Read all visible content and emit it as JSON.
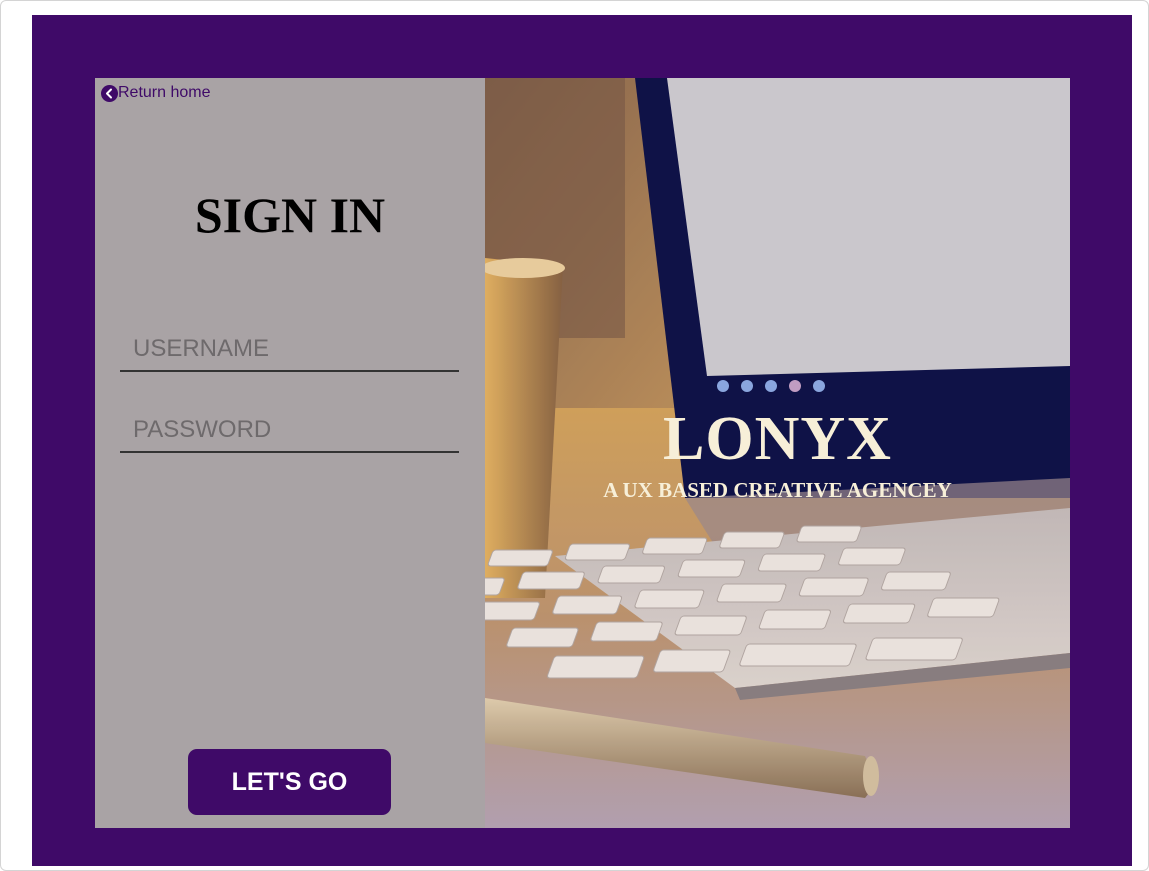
{
  "nav": {
    "return_label": "Return home",
    "return_icon": "chevron-left-circle-icon"
  },
  "signin": {
    "title": "SIGN IN",
    "username_placeholder": "USERNAME",
    "password_placeholder": "PASSWORD",
    "submit_label": "LET'S GO"
  },
  "hero": {
    "brand": "LONYX",
    "tagline": "A UX BASED CREATIVE AGENCEY",
    "image_subject": "laptop-keyboard-desk-photo"
  },
  "colors": {
    "primary": "#3f0a68",
    "panel": "#a9a3a5",
    "brand_text": "#f7efd8"
  }
}
